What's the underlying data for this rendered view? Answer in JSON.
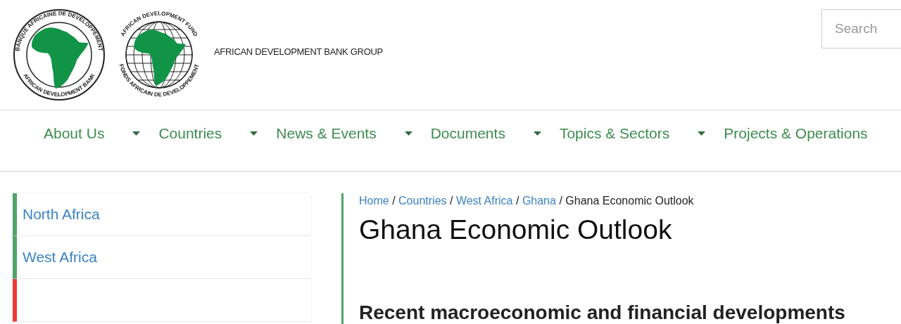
{
  "header": {
    "logo_bank": {
      "ring_top": "BANQUE AFRICAINE DE DEVELOPPEMENT",
      "ring_bottom": "AFRICAN DEVELOPMENT BANK"
    },
    "logo_fund": {
      "ring_top": "AFRICAN DEVELOPMENT FUND",
      "ring_bottom": "FONDS AFRICAIN DE DEVELOPPEMENT"
    },
    "group_name": "AFRICAN DEVELOPMENT BANK GROUP",
    "search": {
      "placeholder": "Search"
    }
  },
  "nav": [
    {
      "label": "About Us",
      "has_menu": true
    },
    {
      "label": "Countries",
      "has_menu": true
    },
    {
      "label": "News & Events",
      "has_menu": true
    },
    {
      "label": "Documents",
      "has_menu": true
    },
    {
      "label": "Topics & Sectors",
      "has_menu": true
    },
    {
      "label": "Projects & Operations",
      "has_menu": false
    }
  ],
  "sidebar": [
    {
      "label": "North Africa",
      "color": "#4fa36b"
    },
    {
      "label": "West Africa",
      "color": "#4fa36b"
    },
    {
      "color": "#ee3a35"
    }
  ],
  "breadcrumb": [
    {
      "kind": "link",
      "label": "Home",
      "separator": "/"
    },
    {
      "kind": "link",
      "label": "Countries",
      "separator": "/"
    },
    {
      "kind": "link",
      "label": "West Africa",
      "separator": "/"
    },
    {
      "kind": "link",
      "label": "Ghana",
      "separator": "/"
    },
    {
      "kind": "current",
      "label": "Ghana Economic Outlook"
    }
  ],
  "title": "Ghana Economic Outlook",
  "section_heading": "Recent macroeconomic and financial developments"
}
